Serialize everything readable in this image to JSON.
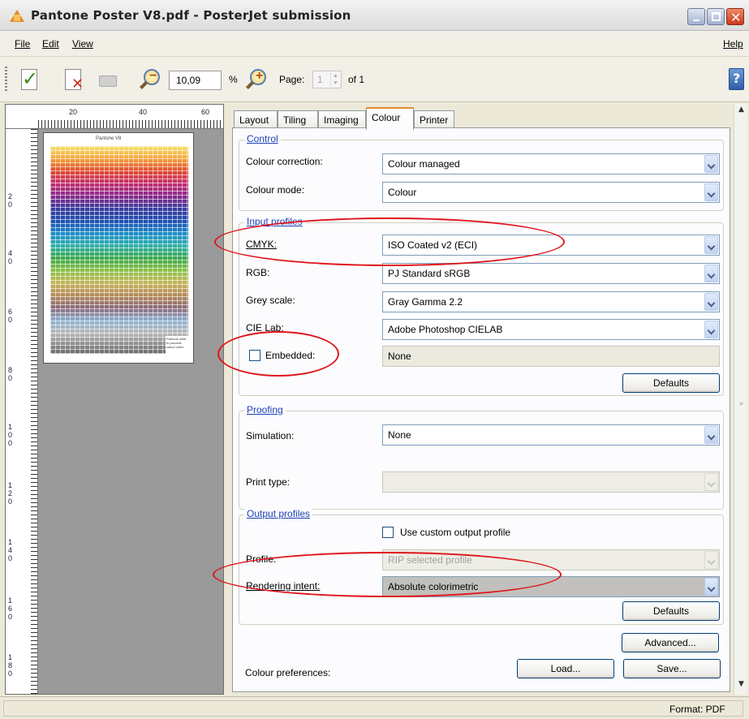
{
  "window": {
    "title": "Pantone Poster V8.pdf - PosterJet submission",
    "minimize": "_",
    "maximize": "□",
    "close": "✕"
  },
  "menu": {
    "file": "File",
    "edit": "Edit",
    "view": "View",
    "help": "Help"
  },
  "toolbar": {
    "zoom_value": "10,09",
    "zoom_unit": "%",
    "page_label": "Page:",
    "page_value": "1",
    "page_total": "of 1",
    "icons": [
      "submit-check-icon",
      "cancel-x-icon",
      "print-icon",
      "zoom-out-icon",
      "zoom-in-icon",
      "help-icon"
    ]
  },
  "preview": {
    "ruler_top": [
      "20",
      "40",
      "60"
    ],
    "ruler_left": [
      "2\n0",
      "4\n0",
      "6\n0",
      "8\n0",
      "1\n0\n0",
      "1\n2\n0",
      "1\n4\n0",
      "1\n6\n0",
      "1\n8\n0"
    ],
    "poster_title": "Pantone V8",
    "poster_note": "Pantone solid to process colour chart"
  },
  "tabs": [
    "Layout",
    "Tiling",
    "Imaging",
    "Colour",
    "Printer"
  ],
  "active_tab": "Colour",
  "control": {
    "title": "Control",
    "colour_correction_label": "Colour correction:",
    "colour_correction_value": "Colour managed",
    "colour_mode_label": "Colour mode:",
    "colour_mode_value": "Colour"
  },
  "input_profiles": {
    "title": "Input profiles",
    "cmyk_label": "CMYK:",
    "cmyk_value": "ISO Coated v2 (ECI)",
    "rgb_label": "RGB:",
    "rgb_value": "PJ Standard sRGB",
    "grey_label": "Grey scale:",
    "grey_value": "Gray Gamma 2.2",
    "cielab_label": "CIE Lab:",
    "cielab_value": "Adobe Photoshop CIELAB",
    "embedded_label": "Embedded:",
    "embedded_checked": false,
    "embedded_value": "None",
    "defaults_button": "Defaults"
  },
  "proofing": {
    "title": "Proofing",
    "simulation_label": "Simulation:",
    "simulation_value": "None",
    "print_type_label": "Print type:",
    "print_type_value": ""
  },
  "output_profiles": {
    "title": "Output profiles",
    "custom_profile_label": "Use custom output profile",
    "custom_profile_checked": false,
    "profile_label": "Profile:",
    "profile_value": "RIP selected profile",
    "rendering_intent_label": "Rendering intent:",
    "rendering_intent_value": "Absolute colorimetric",
    "defaults_button": "Defaults"
  },
  "footer": {
    "advanced_button": "Advanced...",
    "colour_preferences_label": "Colour preferences:",
    "load_button": "Load...",
    "save_button": "Save..."
  },
  "status": {
    "format": "Format:  PDF"
  },
  "colors": {
    "highlight_ellipse": "#e0141b",
    "group_title": "#1e3fb8",
    "active_tab_accent": "#e68b2c"
  }
}
